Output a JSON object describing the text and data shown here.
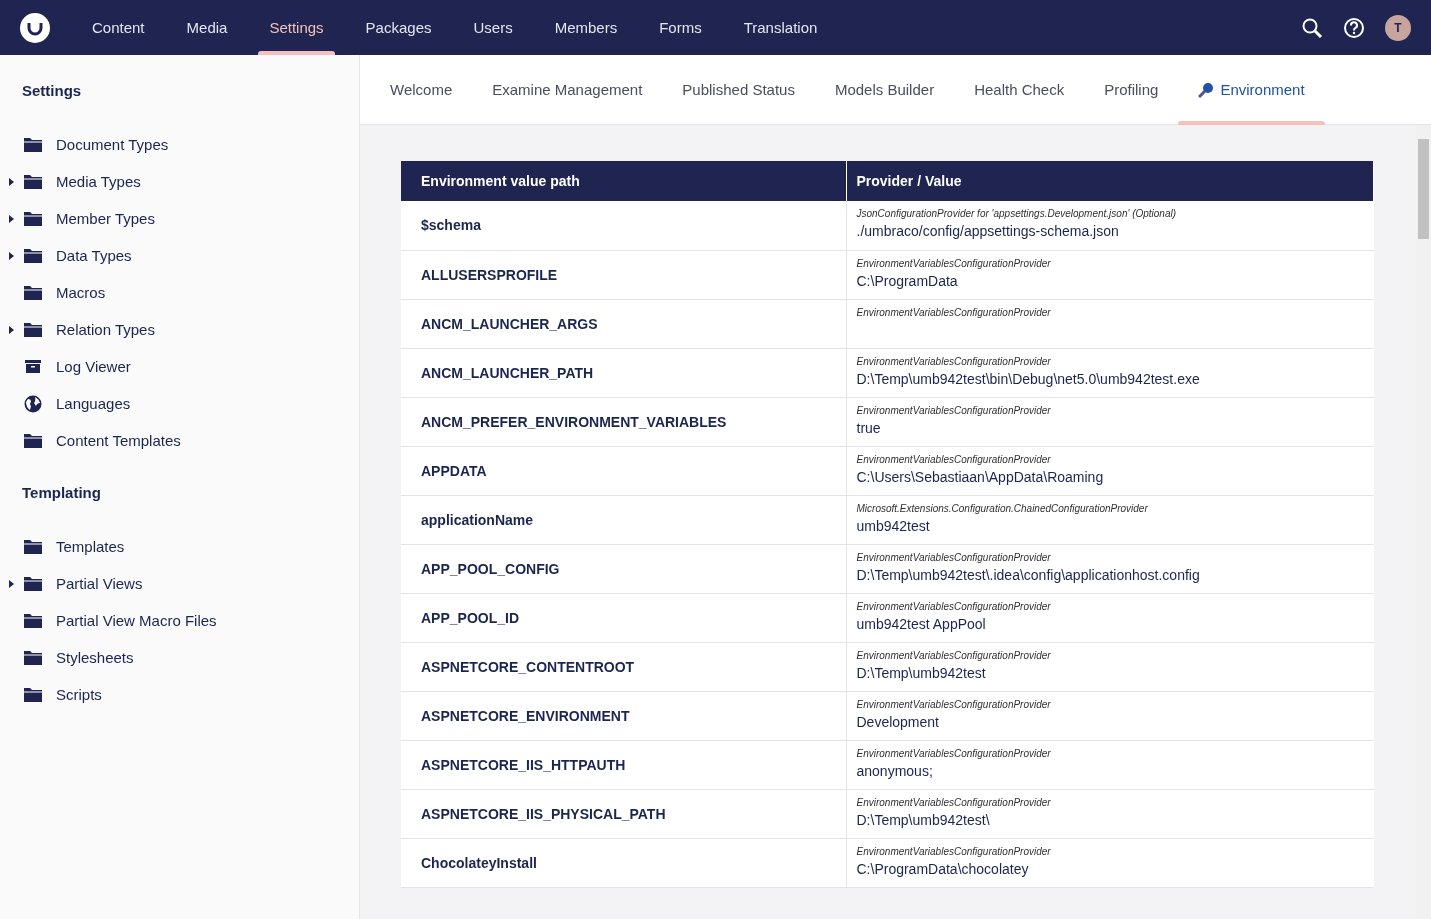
{
  "topbar": {
    "avatar": "T",
    "sections": [
      {
        "label": "Content",
        "selected": false
      },
      {
        "label": "Media",
        "selected": false
      },
      {
        "label": "Settings",
        "selected": true
      },
      {
        "label": "Packages",
        "selected": false
      },
      {
        "label": "Users",
        "selected": false
      },
      {
        "label": "Members",
        "selected": false
      },
      {
        "label": "Forms",
        "selected": false
      },
      {
        "label": "Translation",
        "selected": false
      }
    ]
  },
  "sidebar": {
    "groups": [
      {
        "title": "Settings",
        "items": [
          {
            "label": "Document Types",
            "kind": "folder",
            "expandable": false
          },
          {
            "label": "Media Types",
            "kind": "folder",
            "expandable": true
          },
          {
            "label": "Member Types",
            "kind": "folder",
            "expandable": true
          },
          {
            "label": "Data Types",
            "kind": "folder",
            "expandable": true
          },
          {
            "label": "Macros",
            "kind": "folder",
            "expandable": false
          },
          {
            "label": "Relation Types",
            "kind": "folder",
            "expandable": true
          },
          {
            "label": "Log Viewer",
            "kind": "archive",
            "expandable": false
          },
          {
            "label": "Languages",
            "kind": "globe",
            "expandable": false
          },
          {
            "label": "Content Templates",
            "kind": "folder",
            "expandable": false
          }
        ]
      },
      {
        "title": "Templating",
        "items": [
          {
            "label": "Templates",
            "kind": "folder",
            "expandable": false
          },
          {
            "label": "Partial Views",
            "kind": "folder",
            "expandable": true
          },
          {
            "label": "Partial View Macro Files",
            "kind": "folder",
            "expandable": false
          },
          {
            "label": "Stylesheets",
            "kind": "folder",
            "expandable": false
          },
          {
            "label": "Scripts",
            "kind": "folder",
            "expandable": false
          }
        ]
      }
    ]
  },
  "tabs": [
    {
      "label": "Welcome",
      "selected": false,
      "icon": false
    },
    {
      "label": "Examine Management",
      "selected": false,
      "icon": false
    },
    {
      "label": "Published Status",
      "selected": false,
      "icon": false
    },
    {
      "label": "Models Builder",
      "selected": false,
      "icon": false
    },
    {
      "label": "Health Check",
      "selected": false,
      "icon": false
    },
    {
      "label": "Profiling",
      "selected": false,
      "icon": false
    },
    {
      "label": "Environment",
      "selected": true,
      "icon": true
    }
  ],
  "table": {
    "columns": [
      "Environment value path",
      "Provider / Value"
    ],
    "rows": [
      {
        "path": "$schema",
        "provider": "JsonConfigurationProvider for 'appsettings.Development.json' (Optional)",
        "value": "./umbraco/config/appsettings-schema.json"
      },
      {
        "path": "ALLUSERSPROFILE",
        "provider": "EnvironmentVariablesConfigurationProvider",
        "value": "C:\\ProgramData"
      },
      {
        "path": "ANCM_LAUNCHER_ARGS",
        "provider": "EnvironmentVariablesConfigurationProvider",
        "value": ""
      },
      {
        "path": "ANCM_LAUNCHER_PATH",
        "provider": "EnvironmentVariablesConfigurationProvider",
        "value": "D:\\Temp\\umb942test\\bin\\Debug\\net5.0\\umb942test.exe"
      },
      {
        "path": "ANCM_PREFER_ENVIRONMENT_VARIABLES",
        "provider": "EnvironmentVariablesConfigurationProvider",
        "value": "true"
      },
      {
        "path": "APPDATA",
        "provider": "EnvironmentVariablesConfigurationProvider",
        "value": "C:\\Users\\Sebastiaan\\AppData\\Roaming"
      },
      {
        "path": "applicationName",
        "provider": "Microsoft.Extensions.Configuration.ChainedConfigurationProvider",
        "value": "umb942test"
      },
      {
        "path": "APP_POOL_CONFIG",
        "provider": "EnvironmentVariablesConfigurationProvider",
        "value": "D:\\Temp\\umb942test\\.idea\\config\\applicationhost.config"
      },
      {
        "path": "APP_POOL_ID",
        "provider": "EnvironmentVariablesConfigurationProvider",
        "value": "umb942test AppPool"
      },
      {
        "path": "ASPNETCORE_CONTENTROOT",
        "provider": "EnvironmentVariablesConfigurationProvider",
        "value": "D:\\Temp\\umb942test"
      },
      {
        "path": "ASPNETCORE_ENVIRONMENT",
        "provider": "EnvironmentVariablesConfigurationProvider",
        "value": "Development"
      },
      {
        "path": "ASPNETCORE_IIS_HTTPAUTH",
        "provider": "EnvironmentVariablesConfigurationProvider",
        "value": "anonymous;"
      },
      {
        "path": "ASPNETCORE_IIS_PHYSICAL_PATH",
        "provider": "EnvironmentVariablesConfigurationProvider",
        "value": "D:\\Temp\\umb942test\\"
      },
      {
        "path": "ChocolateyInstall",
        "provider": "EnvironmentVariablesConfigurationProvider",
        "value": "C:\\ProgramData\\chocolatey"
      }
    ]
  }
}
